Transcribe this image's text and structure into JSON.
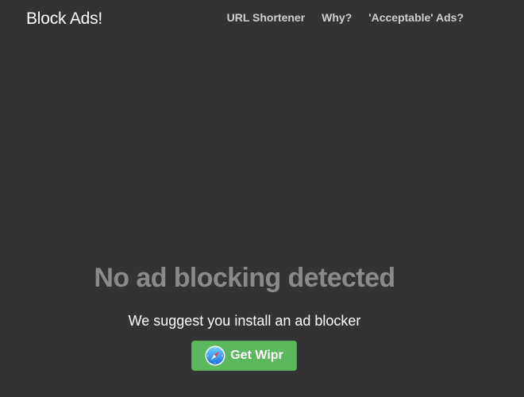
{
  "header": {
    "brand": "Block Ads!",
    "nav": [
      {
        "label": "URL Shortener"
      },
      {
        "label": "Why?"
      },
      {
        "label": "'Acceptable' Ads?"
      }
    ]
  },
  "hero": {
    "title": "No ad blocking detected",
    "subtitle": "We suggest you install an ad blocker",
    "cta": {
      "label": "Get Wipr",
      "icon": "safari-compass-icon"
    }
  },
  "colors": {
    "background": "#333333",
    "cta_background": "#5cb85c",
    "title_color": "#8a8a8a",
    "nav_color": "#cfcfcf"
  }
}
